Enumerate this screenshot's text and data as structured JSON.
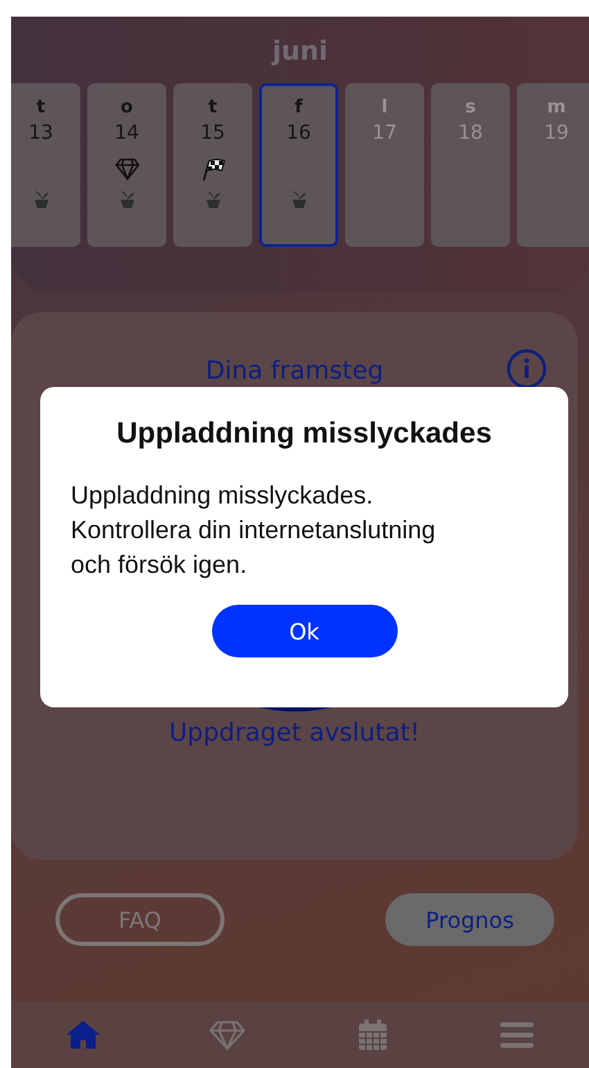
{
  "calendar": {
    "month": "juni",
    "days": [
      {
        "weekday": "t",
        "date": "13",
        "selected": false,
        "future": false,
        "diamond": false,
        "flag": false,
        "plant": true
      },
      {
        "weekday": "o",
        "date": "14",
        "selected": false,
        "future": false,
        "diamond": true,
        "flag": false,
        "plant": true
      },
      {
        "weekday": "t",
        "date": "15",
        "selected": false,
        "future": false,
        "diamond": false,
        "flag": true,
        "plant": true
      },
      {
        "weekday": "f",
        "date": "16",
        "selected": true,
        "future": false,
        "diamond": false,
        "flag": false,
        "plant": true
      },
      {
        "weekday": "l",
        "date": "17",
        "selected": false,
        "future": true,
        "diamond": false,
        "flag": false,
        "plant": false
      },
      {
        "weekday": "s",
        "date": "18",
        "selected": false,
        "future": true,
        "diamond": false,
        "flag": false,
        "plant": false
      },
      {
        "weekday": "m",
        "date": "19",
        "selected": false,
        "future": true,
        "diamond": false,
        "flag": false,
        "plant": false
      }
    ]
  },
  "progress": {
    "title": "Dina framsteg",
    "status": "Uppdraget avslutat!"
  },
  "buttons": [
    {
      "label": "FAQ",
      "kind": "outline"
    },
    {
      "label": "Prognos",
      "kind": "filled"
    }
  ],
  "nav": [
    {
      "kind": "home",
      "selected": true
    },
    {
      "kind": "diamond",
      "selected": false
    },
    {
      "kind": "calendar",
      "selected": false
    },
    {
      "kind": "menu",
      "selected": false
    }
  ],
  "dialog": {
    "title": "Uppladdning misslyckades",
    "message": "Uppladdning misslyckades. Kontrollera din internetanslutning och försök igen.",
    "button": "Ok"
  }
}
